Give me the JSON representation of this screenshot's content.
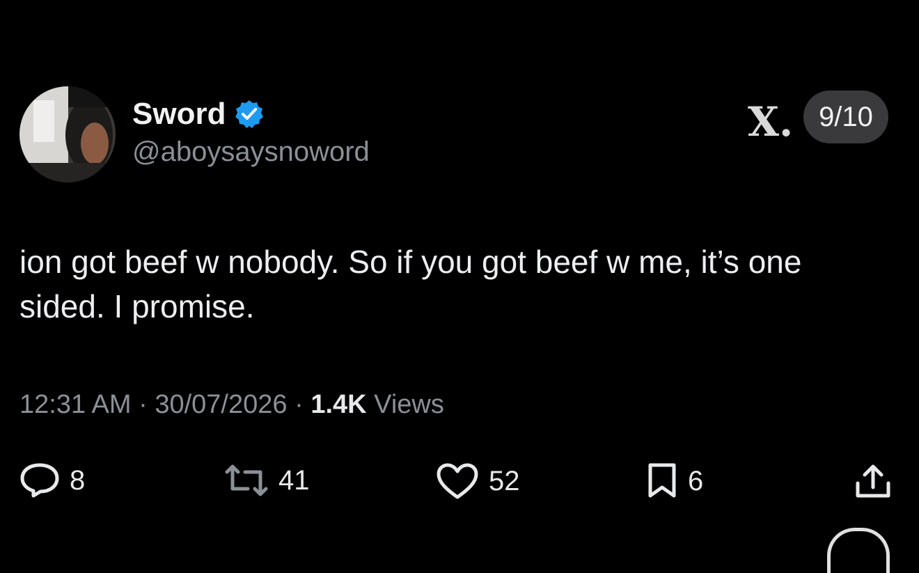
{
  "author": {
    "display_name": "Sword",
    "handle": "@aboysaysnoword",
    "verified": true
  },
  "header": {
    "logo_text": "X.",
    "page_counter": "9/10"
  },
  "tweet": {
    "text": "ion got beef w nobody. So if you got beef w me, it’s one sided. I promise.",
    "time": "12:31 AM",
    "date": "30/07/2026",
    "views_count": "1.4K",
    "views_label": "Views",
    "separator": "·"
  },
  "actions": {
    "replies": "8",
    "reposts": "41",
    "likes": "52",
    "bookmarks": "6"
  },
  "colors": {
    "background": "#000000",
    "text_primary": "#e7e9ea",
    "text_secondary": "#8b9097",
    "verified_blue": "#1d9bf0"
  },
  "icons": {
    "reply": "reply-icon",
    "repost": "repost-icon",
    "like": "heart-icon",
    "bookmark": "bookmark-icon",
    "share": "share-icon",
    "verified": "verified-badge-icon"
  }
}
